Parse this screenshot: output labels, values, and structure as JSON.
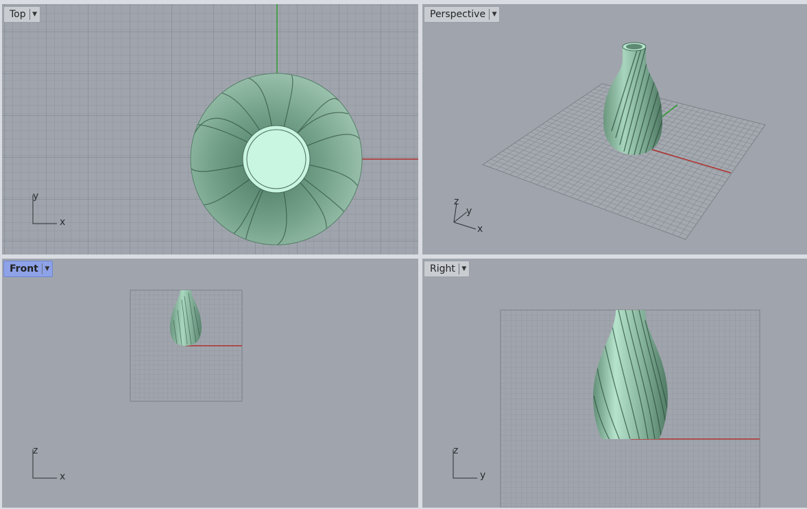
{
  "viewports": {
    "top": {
      "label": "Top",
      "axis_labels": [
        "y",
        "x"
      ]
    },
    "perspective": {
      "label": "Perspective",
      "axis_labels": [
        "z",
        "y",
        "x"
      ]
    },
    "front": {
      "label": "Front",
      "active": true,
      "axis_labels": [
        "z",
        "x"
      ]
    },
    "right": {
      "label": "Right",
      "axis_labels": [
        "z",
        "y"
      ]
    }
  },
  "icons": {
    "tab_dropdown": "chevron-down-icon"
  },
  "colors": {
    "viewport_bg": "#a0a5ad",
    "grid_line": "#8e939b",
    "x_axis": "#b0302c",
    "y_axis": "#2e9b2e",
    "model_surface": "#8fbfa6",
    "model_highlight": "#c8f6e0",
    "active_tab": "#8ea2e8"
  },
  "model": {
    "name": "Twisted vase"
  }
}
